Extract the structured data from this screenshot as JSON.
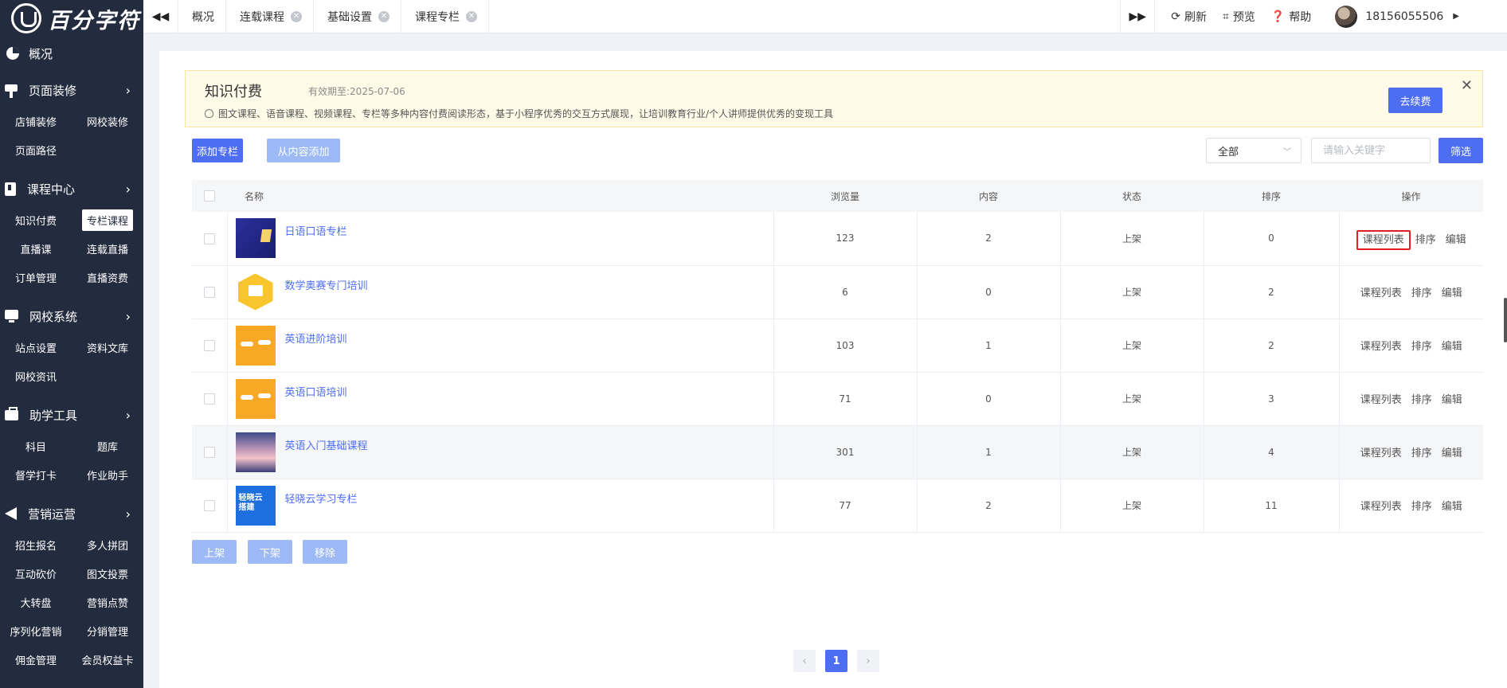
{
  "sidebar": {
    "logo": "百分字符",
    "top_item": "概况",
    "groups": [
      {
        "label": "页面装修",
        "items": [
          "店铺装修",
          "网校装修",
          "页面路径"
        ]
      },
      {
        "label": "课程中心",
        "items": [
          "知识付费",
          "专栏课程",
          "直播课",
          "连载直播",
          "订单管理",
          "直播资费"
        ]
      },
      {
        "label": "网校系统",
        "items": [
          "站点设置",
          "资料文库",
          "网校资讯"
        ]
      },
      {
        "label": "助学工具",
        "items": [
          "科目",
          "题库",
          "督学打卡",
          "作业助手"
        ]
      },
      {
        "label": "营销运营",
        "items": [
          "招生报名",
          "多人拼团",
          "互动砍价",
          "图文投票",
          "大转盘",
          "营销点赞",
          "序列化营销",
          "分销管理",
          "佣金管理",
          "会员权益卡"
        ]
      }
    ],
    "active_item": "专栏课程"
  },
  "topbar": {
    "prev_icon": "double-left-icon",
    "next_icon": "double-right-icon",
    "tabs": [
      {
        "label": "概况",
        "closable": false
      },
      {
        "label": "连载课程",
        "closable": true
      },
      {
        "label": "基础设置",
        "closable": true
      },
      {
        "label": "课程专栏",
        "closable": true
      }
    ],
    "refresh": "刷新",
    "preview": "预览",
    "help": "帮助",
    "user_phone": "18156055506"
  },
  "notice": {
    "title": "知识付费",
    "expiry": "有效期至:2025-07-06",
    "description": "图文课程、语音课程、视频课程、专栏等多种内容付费阅读形态，基于小程序优秀的交互方式展现，让培训教育行业/个人讲师提供优秀的变现工具",
    "renew_button": "去续费"
  },
  "toolbar": {
    "add_column": "添加专栏",
    "add_from_content": "从内容添加",
    "filter_select": "全部",
    "search_placeholder": "请输入关键字",
    "filter_button": "筛选"
  },
  "table": {
    "headers": {
      "name": "名称",
      "views": "浏览量",
      "content": "内容",
      "status": "状态",
      "sort": "排序",
      "ops": "操作"
    },
    "rows": [
      {
        "name": "日语口语专栏",
        "views": "123",
        "content": "2",
        "status": "上架",
        "sort": "0"
      },
      {
        "name": "数学奥赛专门培训",
        "views": "6",
        "content": "0",
        "status": "上架",
        "sort": "2"
      },
      {
        "name": "英语进阶培训",
        "views": "103",
        "content": "1",
        "status": "上架",
        "sort": "2"
      },
      {
        "name": "英语口语培训",
        "views": "71",
        "content": "0",
        "status": "上架",
        "sort": "3"
      },
      {
        "name": "英语入门基础课程",
        "views": "301",
        "content": "1",
        "status": "上架",
        "sort": "4"
      },
      {
        "name": "轻晓云学习专栏",
        "views": "77",
        "content": "2",
        "status": "上架",
        "sort": "11"
      }
    ],
    "op_labels": {
      "list": "课程列表",
      "sort": "排序",
      "edit": "编辑"
    },
    "thumb6_text": "轻晓云 搭建"
  },
  "bulk": {
    "on_shelf": "上架",
    "off_shelf": "下架",
    "remove": "移除"
  },
  "pagination": {
    "current": "1"
  },
  "colors": {
    "primary": "#4e6ef2",
    "sidebar_bg": "#232b3e",
    "highlight_border": "#e02020"
  }
}
